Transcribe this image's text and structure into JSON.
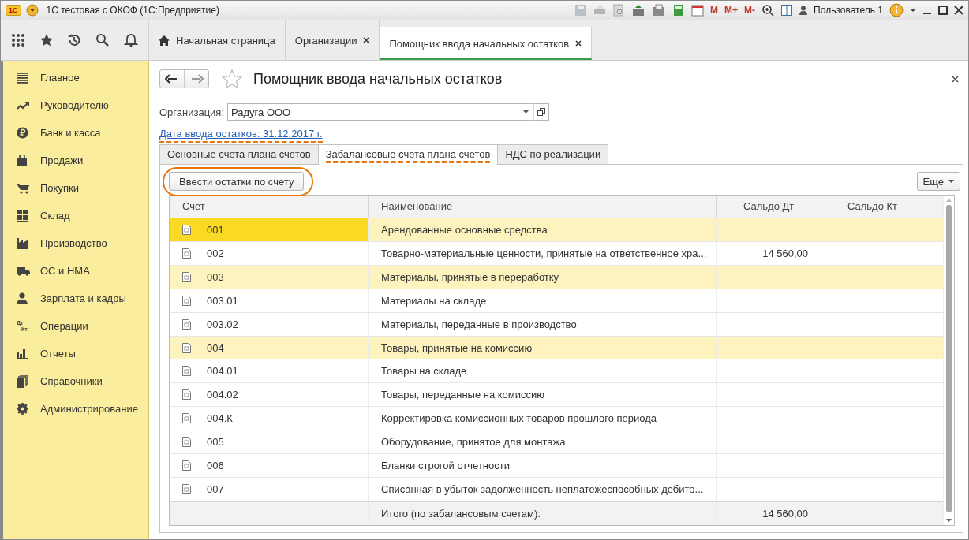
{
  "window": {
    "logo": "1С",
    "title": "1С тестовая с ОКОФ  (1С:Предприятие)",
    "memory_buttons": [
      "M",
      "M+",
      "M-"
    ],
    "user": "Пользователь 1"
  },
  "open_tabs": [
    {
      "label": "Начальная страница",
      "kind": "home",
      "selected": false,
      "closable": false
    },
    {
      "label": "Организации",
      "kind": "plain",
      "selected": false,
      "closable": true
    },
    {
      "label": "Помощник ввода начальных остатков",
      "kind": "plain",
      "selected": true,
      "closable": true
    }
  ],
  "sidebar": {
    "items": [
      {
        "label": "Главное",
        "kind": "list"
      },
      {
        "label": "Руководителю",
        "kind": "trend"
      },
      {
        "label": "Банк и касса",
        "kind": "coin"
      },
      {
        "label": "Продажи",
        "kind": "bag"
      },
      {
        "label": "Покупки",
        "kind": "cart"
      },
      {
        "label": "Склад",
        "kind": "grid"
      },
      {
        "label": "Производство",
        "kind": "factory"
      },
      {
        "label": "ОС и НМА",
        "kind": "truck"
      },
      {
        "label": "Зарплата и кадры",
        "kind": "person"
      },
      {
        "label": "Операции",
        "kind": "text",
        "icon_text": [
          "Дт",
          "Кт"
        ]
      },
      {
        "label": "Отчеты",
        "kind": "bars"
      },
      {
        "label": "Справочники",
        "kind": "books"
      },
      {
        "label": "Администрирование",
        "kind": "gear"
      }
    ]
  },
  "form": {
    "title": "Помощник ввода начальных остатков",
    "organization": {
      "label": "Организация:",
      "value": "Радуга ООО"
    },
    "date_link": {
      "text": "Дата ввода остатков: 31.12.2017 г.",
      "highlighted": true
    },
    "tabs": [
      {
        "label": "Основные счета плана счетов",
        "selected": false,
        "highlighted": false
      },
      {
        "label": "Забалансовые счета плана счетов",
        "selected": true,
        "highlighted": true
      },
      {
        "label": "НДС по реализации",
        "selected": false,
        "highlighted": false
      }
    ],
    "enter_button": {
      "label": "Ввести остатки по счету",
      "highlighted": true
    },
    "more_button": "Еще",
    "table": {
      "columns": [
        "Счет",
        "Наименование",
        "Сальдо Дт",
        "Сальдо Кт"
      ],
      "rows": [
        {
          "account": "001",
          "name": "Арендованные основные средства",
          "debit": "",
          "credit": "",
          "group": true,
          "selected": true
        },
        {
          "account": "002",
          "name": "Товарно-материальные ценности, принятые на ответственное хра...",
          "debit": "14 560,00",
          "credit": "",
          "group": false,
          "selected": false
        },
        {
          "account": "003",
          "name": "Материалы, принятые в переработку",
          "debit": "",
          "credit": "",
          "group": true,
          "selected": false
        },
        {
          "account": "003.01",
          "name": "Материалы на складе",
          "debit": "",
          "credit": "",
          "group": false,
          "selected": false
        },
        {
          "account": "003.02",
          "name": "Материалы, переданные в производство",
          "debit": "",
          "credit": "",
          "group": false,
          "selected": false
        },
        {
          "account": "004",
          "name": "Товары, принятые на комиссию",
          "debit": "",
          "credit": "",
          "group": true,
          "selected": false
        },
        {
          "account": "004.01",
          "name": "Товары на складе",
          "debit": "",
          "credit": "",
          "group": false,
          "selected": false
        },
        {
          "account": "004.02",
          "name": "Товары, переданные на комиссию",
          "debit": "",
          "credit": "",
          "group": false,
          "selected": false
        },
        {
          "account": "004.К",
          "name": "Корректировка комиссионных товаров прошлого периода",
          "debit": "",
          "credit": "",
          "group": false,
          "selected": false
        },
        {
          "account": "005",
          "name": "Оборудование, принятое для монтажа",
          "debit": "",
          "credit": "",
          "group": false,
          "selected": false
        },
        {
          "account": "006",
          "name": "Бланки строгой отчетности",
          "debit": "",
          "credit": "",
          "group": false,
          "selected": false
        },
        {
          "account": "007",
          "name": "Списанная в убыток задолженность неплатежеспособных дебито...",
          "debit": "",
          "credit": "",
          "group": false,
          "selected": false
        }
      ],
      "footer": {
        "label": "Итого (по забалансовым счетам):",
        "debit": "14 560,00"
      }
    }
  }
}
